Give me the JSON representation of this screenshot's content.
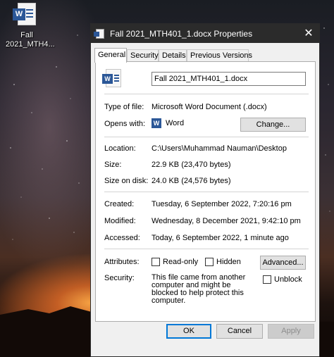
{
  "desktop": {
    "icon_badge": "W",
    "icon_label": "Fall 2021_MTH4..."
  },
  "window": {
    "title": "Fall 2021_MTH401_1.docx Properties",
    "close_glyph": "✕"
  },
  "tabs": [
    {
      "label": "General",
      "active": true
    },
    {
      "label": "Security",
      "active": false
    },
    {
      "label": "Details",
      "active": false
    },
    {
      "label": "Previous Versions",
      "active": false
    }
  ],
  "general": {
    "file_name": "Fall 2021_MTH401_1.docx",
    "file_icon_badge": "W",
    "type_label": "Type of file:",
    "type_value": "Microsoft Word Document (.docx)",
    "opens_label": "Opens with:",
    "opens_badge": "W",
    "opens_value": "Word",
    "change_button": "Change...",
    "location_label": "Location:",
    "location_value": "C:\\Users\\Muhammad Nauman\\Desktop",
    "size_label": "Size:",
    "size_value": "22.9 KB (23,470 bytes)",
    "size_on_disk_label": "Size on disk:",
    "size_on_disk_value": "24.0 KB (24,576 bytes)",
    "created_label": "Created:",
    "created_value": "Tuesday, 6 September 2022, 7:20:16 pm",
    "modified_label": "Modified:",
    "modified_value": "Wednesday, 8 December 2021, 9:42:10 pm",
    "accessed_label": "Accessed:",
    "accessed_value": "Today, 6 September 2022, 1 minute ago",
    "attributes_label": "Attributes:",
    "readonly_label": "Read-only",
    "hidden_label": "Hidden",
    "advanced_button": "Advanced...",
    "security_label": "Security:",
    "security_text": "This file came from another computer and might be blocked to help protect this computer.",
    "unblock_label": "Unblock"
  },
  "footer": {
    "ok": "OK",
    "cancel": "Cancel",
    "apply": "Apply"
  },
  "colors": {
    "accent": "#0078d7",
    "word_blue": "#2b5797",
    "titlebar": "#2b2b2b"
  }
}
